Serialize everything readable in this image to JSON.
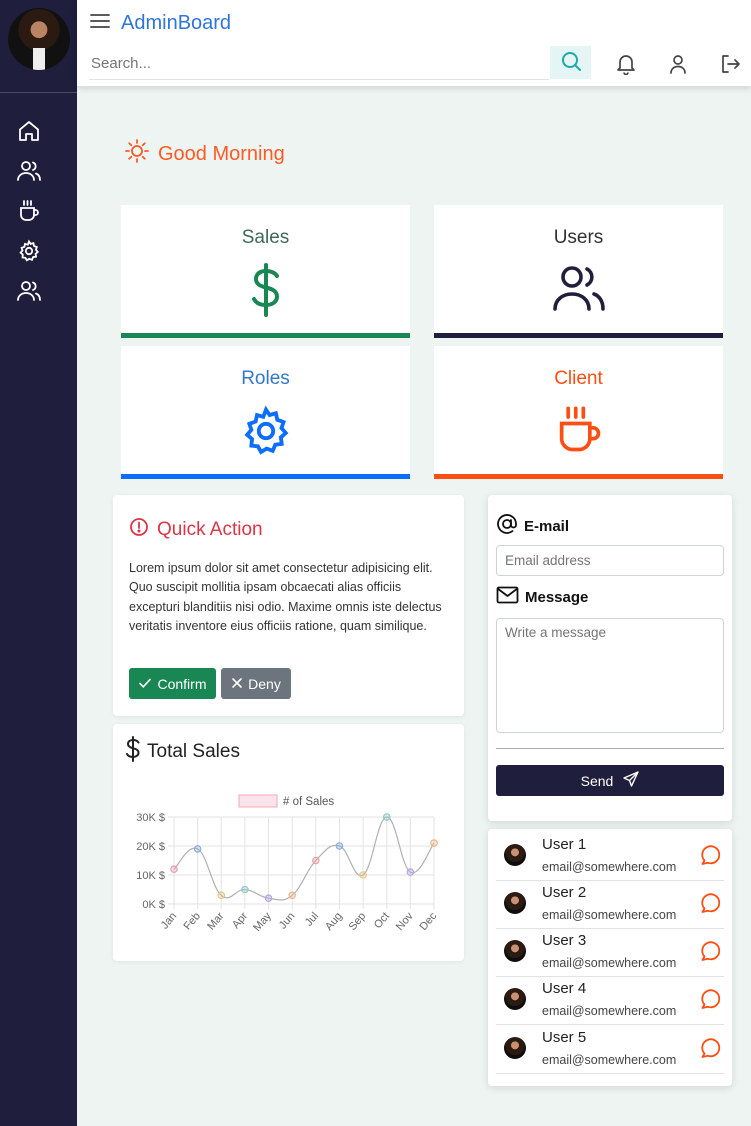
{
  "header": {
    "brand": "AdminBoard",
    "search_placeholder": "Search..."
  },
  "sidebar": {
    "icons": [
      "home-icon",
      "users-icon",
      "coffee-icon",
      "gear-icon",
      "users-icon"
    ]
  },
  "greeting": "Good Morning",
  "stats": [
    {
      "title": "Sales",
      "icon": "dollar-icon",
      "color": "#198754"
    },
    {
      "title": "Users",
      "icon": "users-icon",
      "color": "#1f1e3d"
    },
    {
      "title": "Roles",
      "icon": "gear-icon",
      "color": "#0d6efd"
    },
    {
      "title": "Client",
      "icon": "coffee-icon",
      "color": "#fd4e13"
    }
  ],
  "quick_action": {
    "title": "Quick Action",
    "text": "Lorem ipsum dolor sit amet consectetur adipisicing elit. Quo suscipit mollitia ipsam obcaecati alias officiis excepturi blanditiis nisi odio. Maxime omnis iste delectus veritatis inventore eius officiis ratione, quam similique.",
    "confirm_label": "Confirm",
    "deny_label": "Deny"
  },
  "total_sales": {
    "title": "Total Sales"
  },
  "chart_data": {
    "type": "line",
    "categories": [
      "Jan",
      "Feb",
      "Mar",
      "Apr",
      "May",
      "Jun",
      "Jul",
      "Aug",
      "Sep",
      "Oct",
      "Nov",
      "Dec"
    ],
    "series": [
      {
        "name": "# of Sales",
        "values": [
          12,
          19,
          3,
          5,
          2,
          3,
          15,
          20,
          10,
          30,
          11,
          21
        ]
      }
    ],
    "y_ticks": [
      "0K $",
      "10K $",
      "20K $",
      "30K $"
    ],
    "ylim": [
      0,
      30
    ],
    "legend": "top",
    "grid": true,
    "point_colors": [
      "#e8a0a8",
      "#88aee0",
      "#e6c98a",
      "#8ccac8",
      "#b5a3de",
      "#f0b78a",
      "#e8a0a8",
      "#88aee0",
      "#e6c98a",
      "#8ccac8",
      "#b5a3de",
      "#f0b78a"
    ]
  },
  "contact": {
    "email_label": "E-mail",
    "email_placeholder": "Email address",
    "message_label": "Message",
    "message_placeholder": "Write a message",
    "send_label": "Send"
  },
  "users": [
    {
      "name": "User 1",
      "email": "email@somewhere.com"
    },
    {
      "name": "User 2",
      "email": "email@somewhere.com"
    },
    {
      "name": "User 3",
      "email": "email@somewhere.com"
    },
    {
      "name": "User 4",
      "email": "email@somewhere.com"
    },
    {
      "name": "User 5",
      "email": "email@somewhere.com"
    }
  ]
}
